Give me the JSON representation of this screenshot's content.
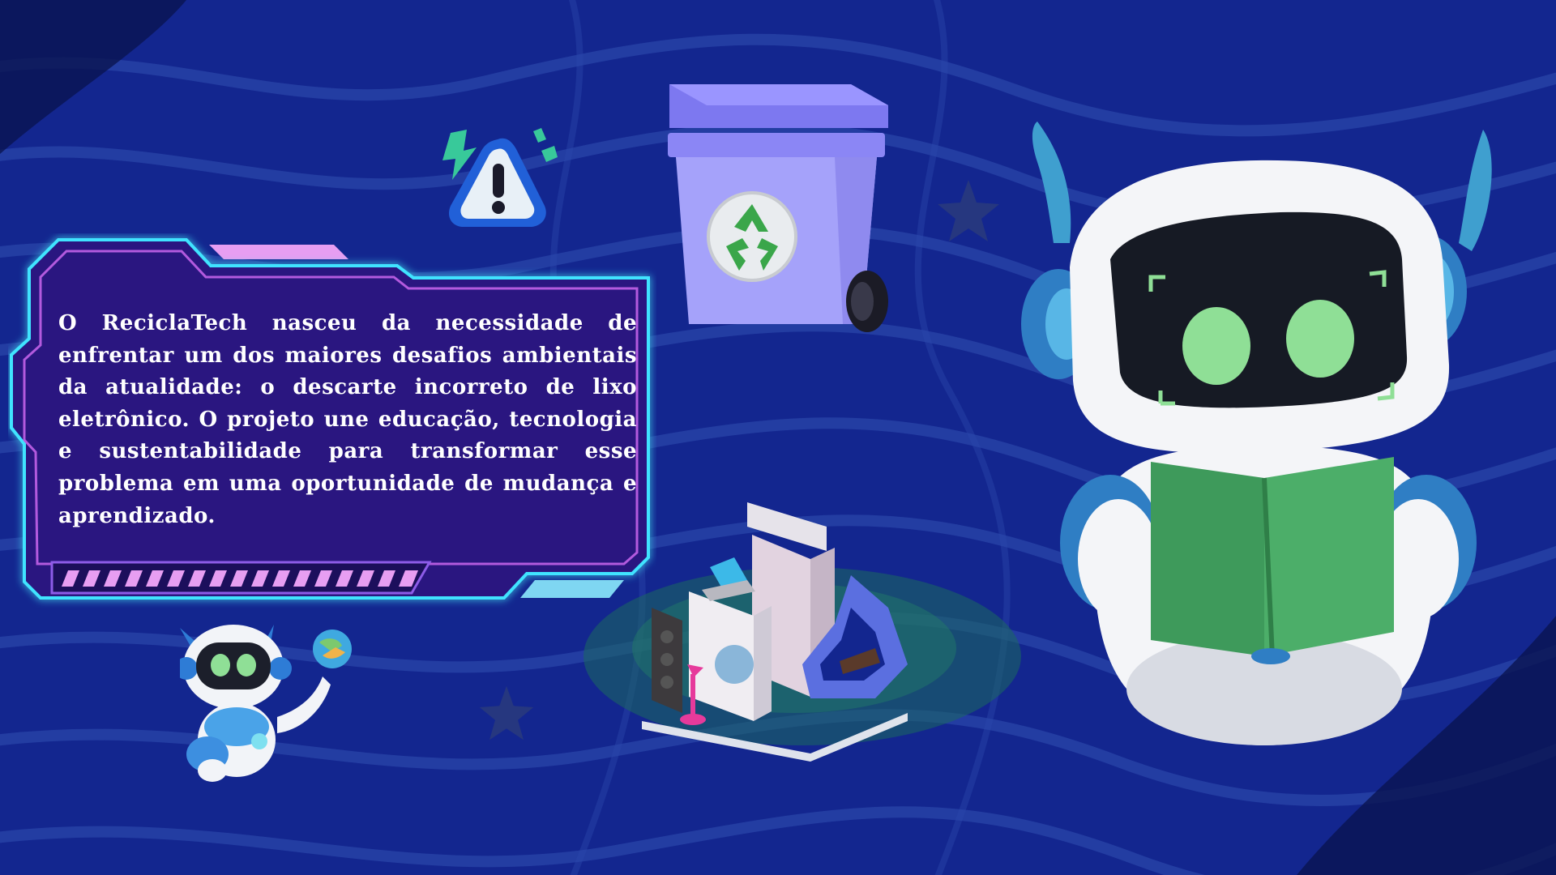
{
  "panel": {
    "text": "O ReciclaTech nasceu da necessidade de enfrentar um dos maiores desafios ambientais da atualidade: o descarte incorreto de lixo eletrônico. O projeto une educação, tecnologia e sustentabilidade para transformar esse problema em uma oportunidade de mudança e aprendizado."
  },
  "colors": {
    "background": "#13268f",
    "panel_fill": "#2a1580",
    "panel_glow": "#3fe3ff",
    "accent_pink": "#e79ef2",
    "accent_cyan": "#7fd6f2",
    "robot_eye_green": "#8fdf96",
    "book_green": "#3e9a5b",
    "bin_purple": "#8b86f5"
  },
  "icons": {
    "warning": "warning-icon",
    "recycle": "recycle-icon",
    "star": "star-icon"
  }
}
